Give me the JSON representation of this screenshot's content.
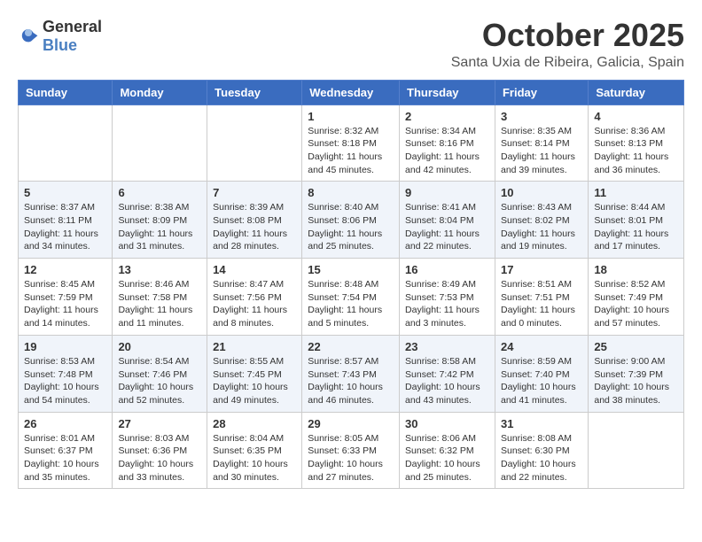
{
  "header": {
    "logo_general": "General",
    "logo_blue": "Blue",
    "month": "October 2025",
    "location": "Santa Uxia de Ribeira, Galicia, Spain"
  },
  "weekdays": [
    "Sunday",
    "Monday",
    "Tuesday",
    "Wednesday",
    "Thursday",
    "Friday",
    "Saturday"
  ],
  "weeks": [
    [
      {
        "day": "",
        "info": ""
      },
      {
        "day": "",
        "info": ""
      },
      {
        "day": "",
        "info": ""
      },
      {
        "day": "1",
        "info": "Sunrise: 8:32 AM\nSunset: 8:18 PM\nDaylight: 11 hours\nand 45 minutes."
      },
      {
        "day": "2",
        "info": "Sunrise: 8:34 AM\nSunset: 8:16 PM\nDaylight: 11 hours\nand 42 minutes."
      },
      {
        "day": "3",
        "info": "Sunrise: 8:35 AM\nSunset: 8:14 PM\nDaylight: 11 hours\nand 39 minutes."
      },
      {
        "day": "4",
        "info": "Sunrise: 8:36 AM\nSunset: 8:13 PM\nDaylight: 11 hours\nand 36 minutes."
      }
    ],
    [
      {
        "day": "5",
        "info": "Sunrise: 8:37 AM\nSunset: 8:11 PM\nDaylight: 11 hours\nand 34 minutes."
      },
      {
        "day": "6",
        "info": "Sunrise: 8:38 AM\nSunset: 8:09 PM\nDaylight: 11 hours\nand 31 minutes."
      },
      {
        "day": "7",
        "info": "Sunrise: 8:39 AM\nSunset: 8:08 PM\nDaylight: 11 hours\nand 28 minutes."
      },
      {
        "day": "8",
        "info": "Sunrise: 8:40 AM\nSunset: 8:06 PM\nDaylight: 11 hours\nand 25 minutes."
      },
      {
        "day": "9",
        "info": "Sunrise: 8:41 AM\nSunset: 8:04 PM\nDaylight: 11 hours\nand 22 minutes."
      },
      {
        "day": "10",
        "info": "Sunrise: 8:43 AM\nSunset: 8:02 PM\nDaylight: 11 hours\nand 19 minutes."
      },
      {
        "day": "11",
        "info": "Sunrise: 8:44 AM\nSunset: 8:01 PM\nDaylight: 11 hours\nand 17 minutes."
      }
    ],
    [
      {
        "day": "12",
        "info": "Sunrise: 8:45 AM\nSunset: 7:59 PM\nDaylight: 11 hours\nand 14 minutes."
      },
      {
        "day": "13",
        "info": "Sunrise: 8:46 AM\nSunset: 7:58 PM\nDaylight: 11 hours\nand 11 minutes."
      },
      {
        "day": "14",
        "info": "Sunrise: 8:47 AM\nSunset: 7:56 PM\nDaylight: 11 hours\nand 8 minutes."
      },
      {
        "day": "15",
        "info": "Sunrise: 8:48 AM\nSunset: 7:54 PM\nDaylight: 11 hours\nand 5 minutes."
      },
      {
        "day": "16",
        "info": "Sunrise: 8:49 AM\nSunset: 7:53 PM\nDaylight: 11 hours\nand 3 minutes."
      },
      {
        "day": "17",
        "info": "Sunrise: 8:51 AM\nSunset: 7:51 PM\nDaylight: 11 hours\nand 0 minutes."
      },
      {
        "day": "18",
        "info": "Sunrise: 8:52 AM\nSunset: 7:49 PM\nDaylight: 10 hours\nand 57 minutes."
      }
    ],
    [
      {
        "day": "19",
        "info": "Sunrise: 8:53 AM\nSunset: 7:48 PM\nDaylight: 10 hours\nand 54 minutes."
      },
      {
        "day": "20",
        "info": "Sunrise: 8:54 AM\nSunset: 7:46 PM\nDaylight: 10 hours\nand 52 minutes."
      },
      {
        "day": "21",
        "info": "Sunrise: 8:55 AM\nSunset: 7:45 PM\nDaylight: 10 hours\nand 49 minutes."
      },
      {
        "day": "22",
        "info": "Sunrise: 8:57 AM\nSunset: 7:43 PM\nDaylight: 10 hours\nand 46 minutes."
      },
      {
        "day": "23",
        "info": "Sunrise: 8:58 AM\nSunset: 7:42 PM\nDaylight: 10 hours\nand 43 minutes."
      },
      {
        "day": "24",
        "info": "Sunrise: 8:59 AM\nSunset: 7:40 PM\nDaylight: 10 hours\nand 41 minutes."
      },
      {
        "day": "25",
        "info": "Sunrise: 9:00 AM\nSunset: 7:39 PM\nDaylight: 10 hours\nand 38 minutes."
      }
    ],
    [
      {
        "day": "26",
        "info": "Sunrise: 8:01 AM\nSunset: 6:37 PM\nDaylight: 10 hours\nand 35 minutes."
      },
      {
        "day": "27",
        "info": "Sunrise: 8:03 AM\nSunset: 6:36 PM\nDaylight: 10 hours\nand 33 minutes."
      },
      {
        "day": "28",
        "info": "Sunrise: 8:04 AM\nSunset: 6:35 PM\nDaylight: 10 hours\nand 30 minutes."
      },
      {
        "day": "29",
        "info": "Sunrise: 8:05 AM\nSunset: 6:33 PM\nDaylight: 10 hours\nand 27 minutes."
      },
      {
        "day": "30",
        "info": "Sunrise: 8:06 AM\nSunset: 6:32 PM\nDaylight: 10 hours\nand 25 minutes."
      },
      {
        "day": "31",
        "info": "Sunrise: 8:08 AM\nSunset: 6:30 PM\nDaylight: 10 hours\nand 22 minutes."
      },
      {
        "day": "",
        "info": ""
      }
    ]
  ]
}
